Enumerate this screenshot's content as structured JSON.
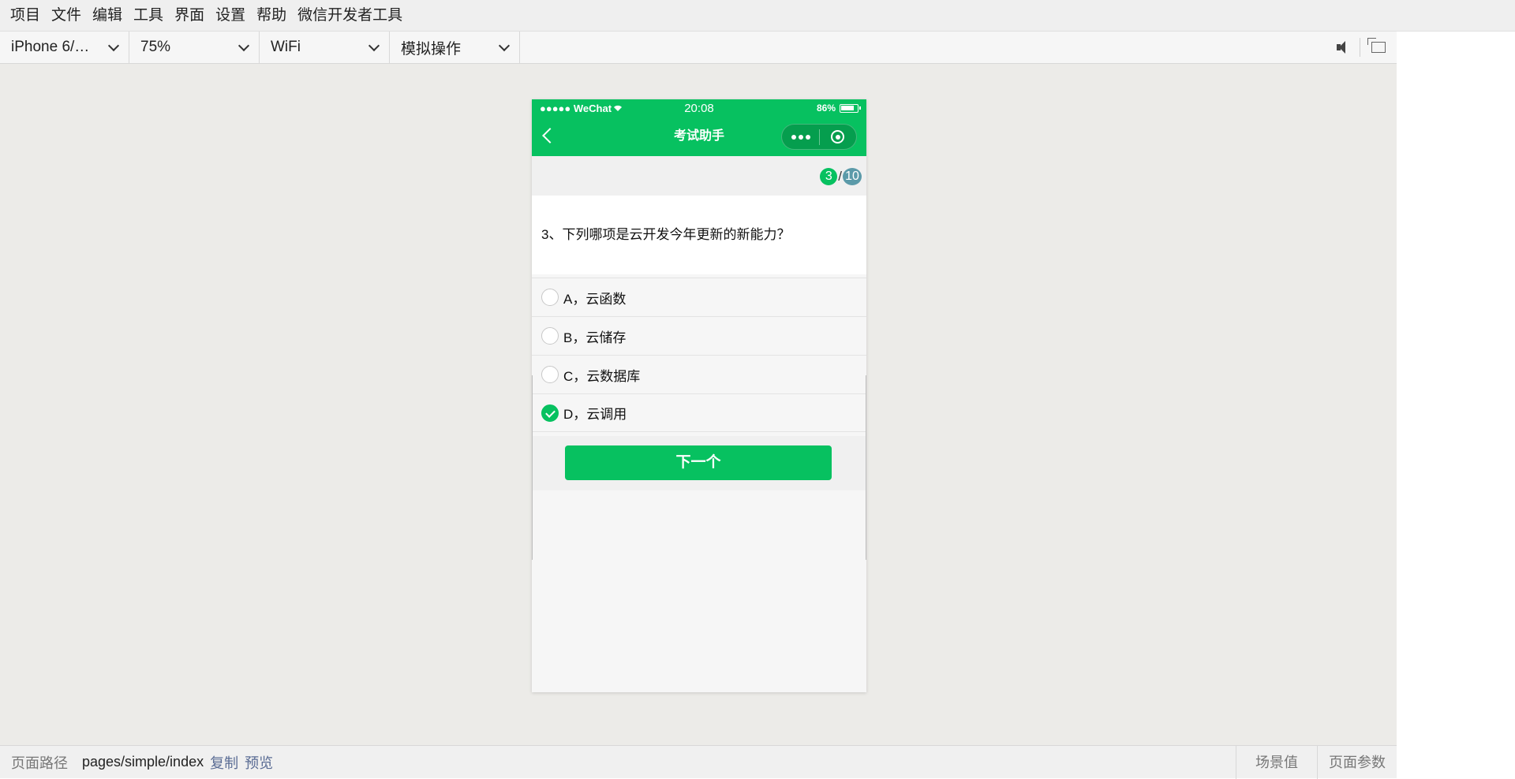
{
  "menubar": {
    "items": [
      "项目",
      "文件",
      "编辑",
      "工具",
      "界面",
      "设置",
      "帮助",
      "微信开发者工具"
    ]
  },
  "toolbar": {
    "device": "iPhone 6/…",
    "zoom": "75%",
    "network": "WiFi",
    "operation": "模拟操作"
  },
  "phone": {
    "status": {
      "carrier": "●●●●● WeChat",
      "time": "20:08",
      "battery_text": "86%",
      "battery_level": 0.86
    },
    "nav": {
      "title": "考试助手"
    },
    "progress": {
      "current": "3",
      "separator": "/",
      "total": "10"
    },
    "question": "3、下列哪项是云开发今年更新的新能力？",
    "options": [
      {
        "label": "A，云函数",
        "checked": false
      },
      {
        "label": "B，云储存",
        "checked": false
      },
      {
        "label": "C，云数据库",
        "checked": false
      },
      {
        "label": "D，云调用",
        "checked": true
      }
    ],
    "next_button": "下一个"
  },
  "bottombar": {
    "path_label": "页面路径",
    "path": "pages/simple/index",
    "copy": "复制",
    "preview": "预览",
    "scene": "场景值",
    "params": "页面参数"
  },
  "colors": {
    "wechat_green": "#07c160",
    "total_badge": "#5b9aa9",
    "link": "#5a6c94"
  }
}
